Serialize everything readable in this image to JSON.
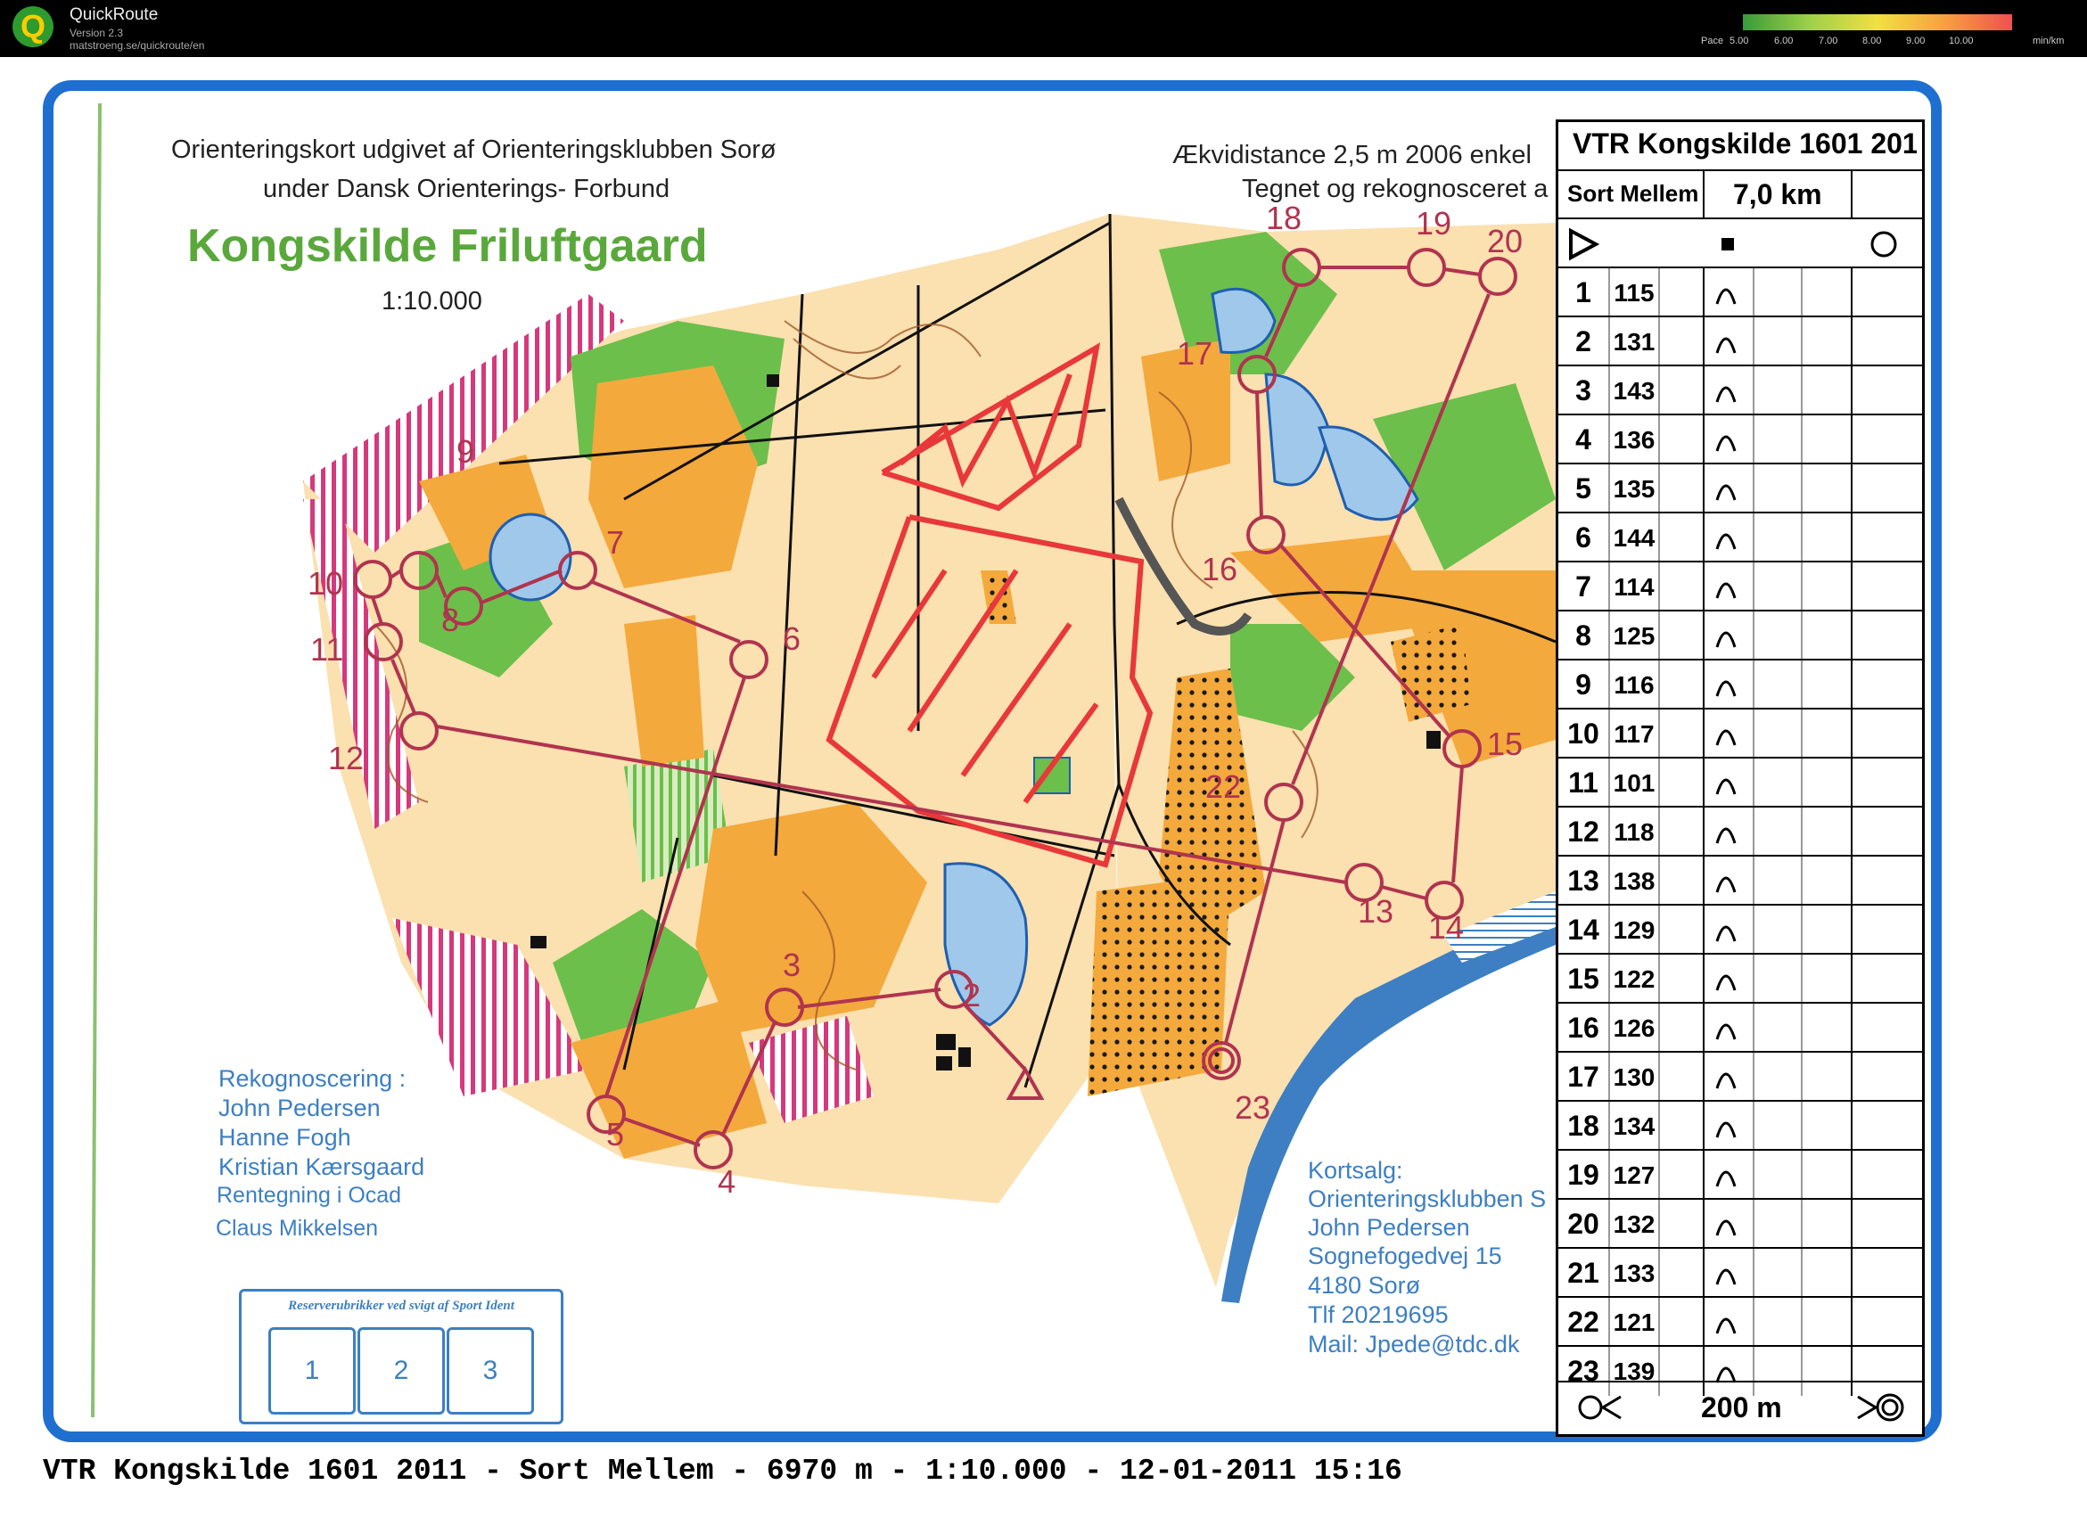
{
  "app": {
    "name": "QuickRoute",
    "version": "Version 2.3",
    "url": "matstroeng.se/quickroute/en",
    "pace_label": "Pace",
    "pace_ticks": [
      "5.00",
      "6.00",
      "7.00",
      "8.00",
      "9.00",
      "10.00"
    ],
    "pace_unit": "min/km"
  },
  "map": {
    "header_line1": "Orienteringskort udgivet af Orienteringsklubben Sorø",
    "header_line2": "under Dansk Orienterings- Forbund",
    "map_title": "Kongskilde Friluftgaard",
    "scale": "1:10.000",
    "equidistance": "Ækvidistance 2,5 m  2006 enkel",
    "drawn_by": "Tegnet og rekognosceret a",
    "credits_title": "Rekognoscering :",
    "credits": [
      "John Pedersen",
      "Hanne Fogh",
      "Kristian Kærsgaard",
      "Rentegning i Ocad",
      "Claus Mikkelsen"
    ],
    "sales": [
      "Kortsalg:",
      "Orienteringsklubben S",
      "John Pedersen",
      "Sognefogedvej 15",
      "4180 Sorø",
      "Tlf 20219695",
      "Mail: Jpede@tdc.dk"
    ],
    "reserve_title": "Reserverubrikker ved  svigt af Sport Ident",
    "reserve_boxes": [
      "1",
      "2",
      "3"
    ],
    "control_labels": [
      "2",
      "3",
      "4",
      "5",
      "6",
      "7",
      "8",
      "9",
      "10",
      "11",
      "12",
      "13",
      "14",
      "15",
      "16",
      "17",
      "18",
      "19",
      "20",
      "22",
      "23"
    ]
  },
  "description": {
    "title": "VTR Kongskilde 1601 201",
    "course": "Sort Mellem",
    "length": "7,0 km",
    "controls": [
      {
        "n": "1",
        "code": "115"
      },
      {
        "n": "2",
        "code": "131"
      },
      {
        "n": "3",
        "code": "143"
      },
      {
        "n": "4",
        "code": "136"
      },
      {
        "n": "5",
        "code": "135"
      },
      {
        "n": "6",
        "code": "144"
      },
      {
        "n": "7",
        "code": "114"
      },
      {
        "n": "8",
        "code": "125"
      },
      {
        "n": "9",
        "code": "116"
      },
      {
        "n": "10",
        "code": "117"
      },
      {
        "n": "11",
        "code": "101"
      },
      {
        "n": "12",
        "code": "118"
      },
      {
        "n": "13",
        "code": "138"
      },
      {
        "n": "14",
        "code": "129"
      },
      {
        "n": "15",
        "code": "122"
      },
      {
        "n": "16",
        "code": "126"
      },
      {
        "n": "17",
        "code": "130"
      },
      {
        "n": "18",
        "code": "134"
      },
      {
        "n": "19",
        "code": "127"
      },
      {
        "n": "20",
        "code": "132"
      },
      {
        "n": "21",
        "code": "133"
      },
      {
        "n": "22",
        "code": "121"
      },
      {
        "n": "23",
        "code": "139"
      }
    ],
    "finish_distance": "200 m"
  },
  "footer": "VTR Kongskilde 1601 2011 - Sort Mellem - 6970 m - 1:10.000 - 12-01-2011 15:16"
}
